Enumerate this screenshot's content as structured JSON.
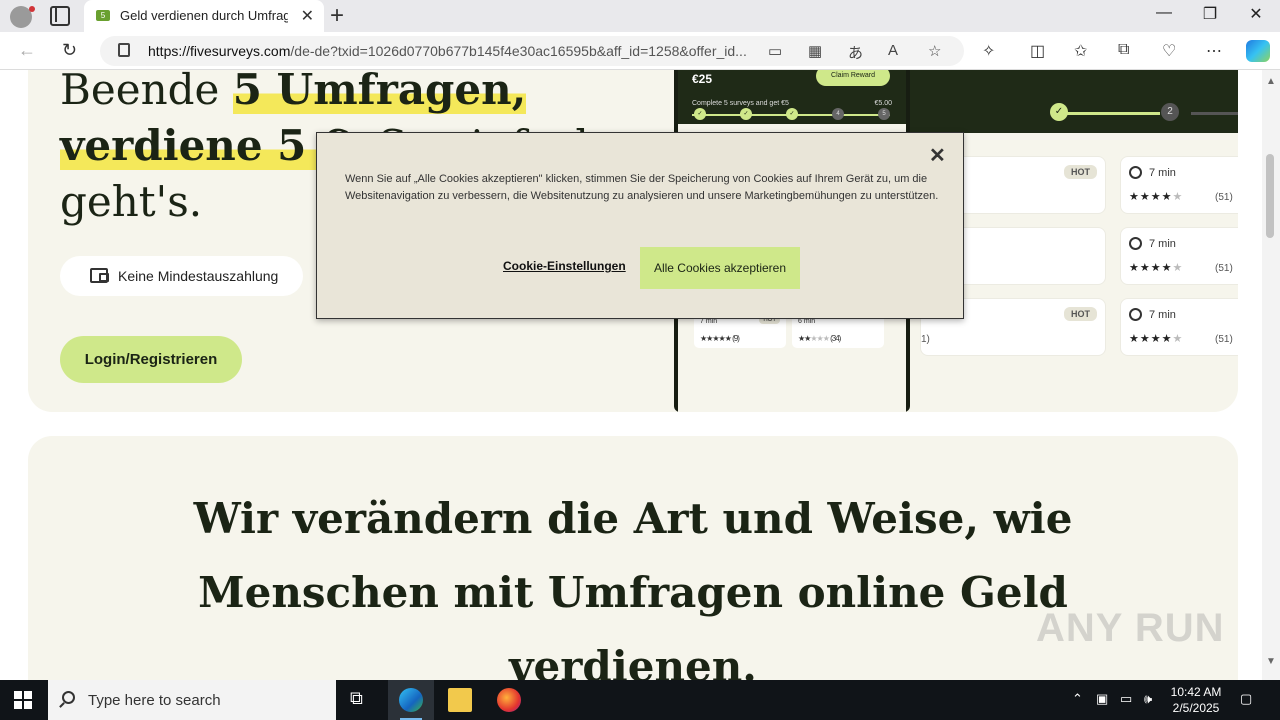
{
  "browser": {
    "tab_title": "Geld verdienen durch Umfragen",
    "favicon_text": "5",
    "url_host": "https://fivesurveys.com",
    "url_rest": "/de-de?txid=1026d0770b677b145f4e30ac16595b&aff_id=1258&offer_id..."
  },
  "hero": {
    "heading_line1_plain": "Beende ",
    "heading_highlight": "5 Umfragen,",
    "heading_line2_highlight": "verdiene 5 €.",
    "heading_line2_plain": " So einfach",
    "heading_line3": "geht's.",
    "pill_label": "Keine Mindestauszahlung",
    "cta_label": "Login/Registrieren"
  },
  "phone": {
    "amount": "€25",
    "claim_label": "Claim Reward",
    "goal_text": "Complete 5 surveys and get €5",
    "goal_value": "€5.00",
    "steps": [
      "4",
      "5"
    ],
    "cards": [
      {
        "time": "7 min",
        "hot": "HOT",
        "stars": 5,
        "count": "(9)"
      },
      {
        "time": "6 min",
        "stars": 2,
        "count": "(34)"
      }
    ]
  },
  "dashboard": {
    "step_label": "2",
    "surveys": [
      {
        "time": "7 min",
        "stars": 4,
        "count": "(51)"
      },
      {
        "time": "7 min",
        "stars": 4,
        "count": "(51)"
      },
      {
        "time": "7 min",
        "stars": 4,
        "count": "(51)"
      }
    ],
    "hot_badge": "HOT",
    "partial_count": "1)"
  },
  "section2": {
    "heading": "Wir verändern die Art und Weise, wie Menschen mit Umfragen online Geld verdienen."
  },
  "cookie_banner": {
    "text": "Wenn Sie auf „Alle Cookies akzeptieren\" klicken, stimmen Sie der Speicherung von Cookies auf Ihrem Gerät zu, um die Websitenavigation zu verbessern, die Websitenutzung zu analysieren und unsere Marketingbemühungen zu unterstützen.",
    "settings_label": "Cookie-Einstellungen",
    "accept_label": "Alle Cookies akzeptieren"
  },
  "taskbar": {
    "search_placeholder": "Type here to search",
    "time": "10:42 AM",
    "date": "2/5/2025"
  },
  "watermark": "ANY RUN"
}
